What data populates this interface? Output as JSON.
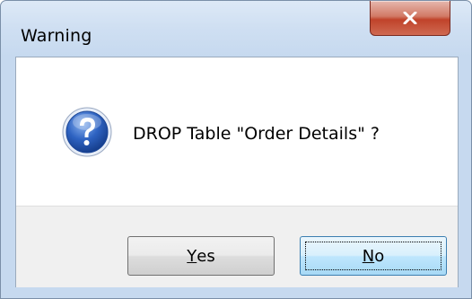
{
  "window": {
    "title": "Warning"
  },
  "dialog": {
    "message": "DROP Table \"Order Details\" ?",
    "icon": "question-icon"
  },
  "buttons": {
    "yes": {
      "mnemonic": "Y",
      "rest": "es"
    },
    "no": {
      "mnemonic": "N",
      "rest": "o"
    }
  },
  "colors": {
    "close_button": "#c0432a",
    "default_button_border": "#3c7fb1",
    "icon_blue": "#1f56b0"
  }
}
